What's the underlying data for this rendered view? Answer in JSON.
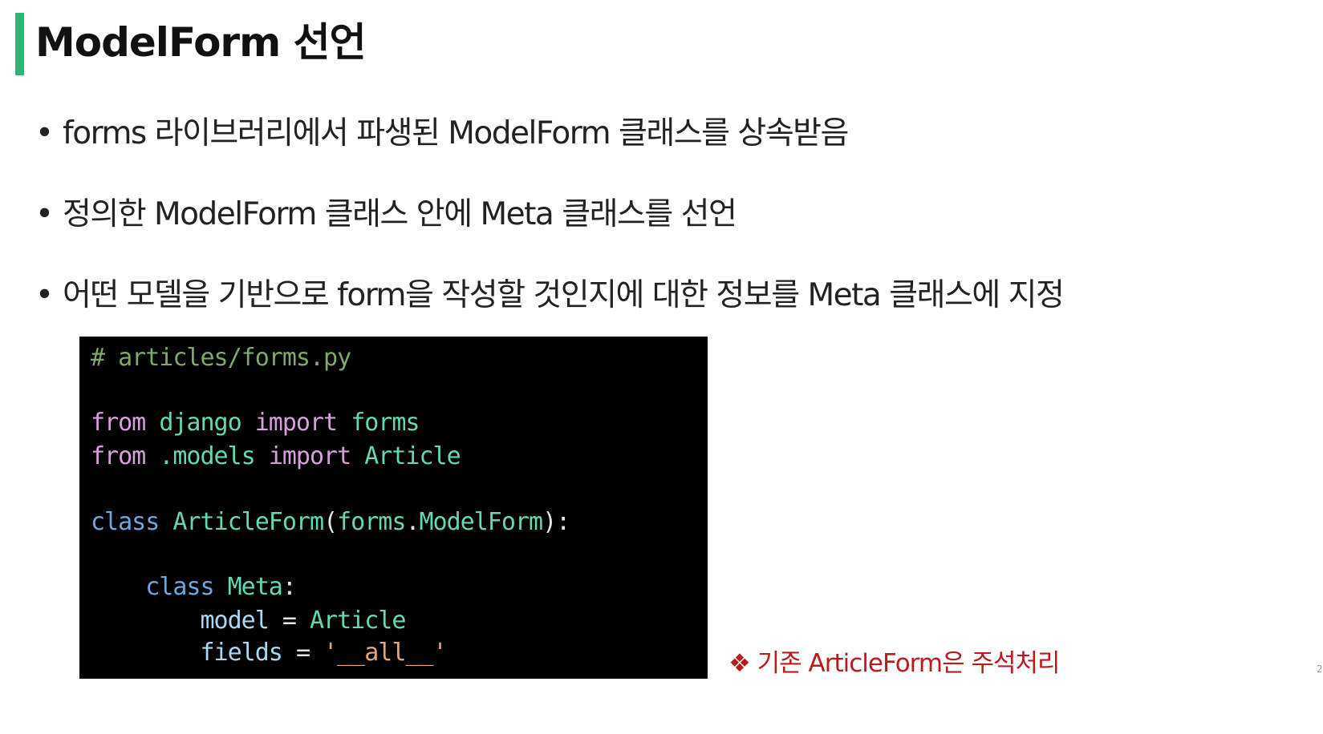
{
  "title": "ModelForm 선언",
  "bullets": [
    "forms 라이브러리에서 파생된 ModelForm 클래스를 상속받음",
    "정의한 ModelForm  클래스 안에 Meta 클래스를 선언",
    "어떤 모델을 기반으로 form을 작성할 것인지에 대한 정보를 Meta 클래스에 지정"
  ],
  "bullet_symbol": "•",
  "code": {
    "comment": "# articles/forms.py",
    "line1": {
      "from": "from",
      "module": "django",
      "import": "import",
      "name": "forms"
    },
    "line2": {
      "from": "from",
      "module": ".models",
      "import": "import",
      "name": "Article"
    },
    "line3": {
      "class": "class",
      "name": "ArticleForm",
      "open": "(",
      "base_mod": "forms",
      "dot": ".",
      "base_cls": "ModelForm",
      "close": "):"
    },
    "line4": {
      "class": "class",
      "name": "Meta",
      "colon": ":"
    },
    "line5": {
      "attr": "model",
      "eq": "=",
      "value": "Article"
    },
    "line6": {
      "attr": "fields",
      "eq": "=",
      "value": "'__all__'"
    }
  },
  "note": "❖ 기존 ArticleForm은 주석처리",
  "page_number": "2",
  "colors": {
    "accent_bar": "#2bb673",
    "code_background": "#000000",
    "note": "#b91c1c"
  }
}
